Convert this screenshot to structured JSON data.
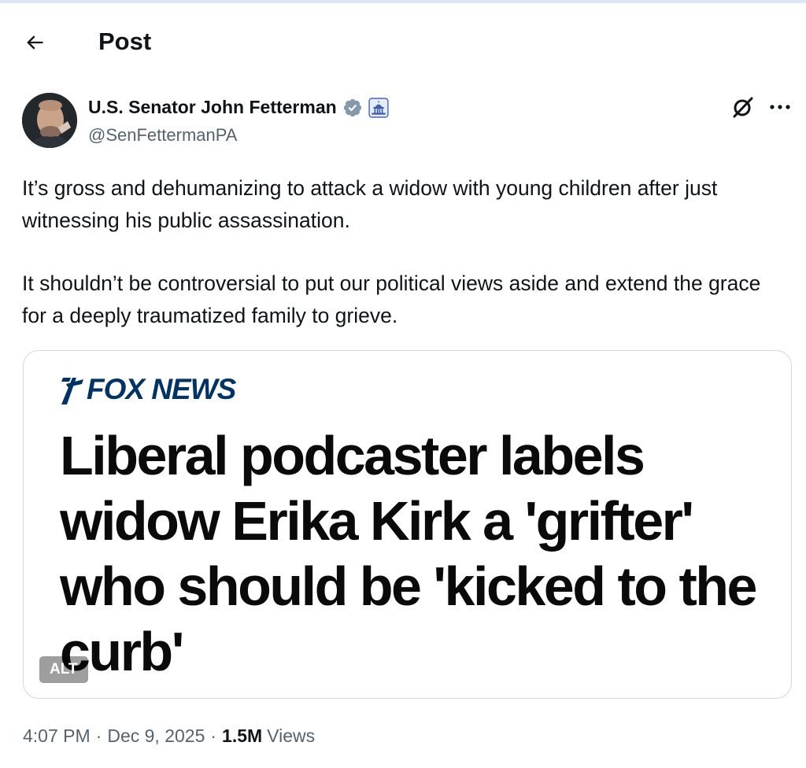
{
  "header": {
    "title": "Post"
  },
  "author": {
    "display_name": "U.S. Senator John Fetterman",
    "handle": "@SenFettermanPA",
    "verified_icon": "verified-badge-icon",
    "affiliation_icon": "us-capitol-icon",
    "verified_color": "#829aab"
  },
  "actions": {
    "grok_icon": "grok-icon",
    "more_icon": "more-icon"
  },
  "tweet": {
    "paragraphs": [
      "It’s gross and dehumanizing to attack a widow with young children after just witnessing his public assassination.",
      "It shouldn’t be controversial to put our political views aside and extend the grace for a deeply traumatized family to grieve."
    ]
  },
  "media": {
    "logo_text": "FOX NEWS",
    "headline": "Liberal podcaster labels widow Erika Kirk a 'grifter' who should be 'kicked to the curb'",
    "alt_label": "ALT",
    "brand_color": "#003366"
  },
  "meta": {
    "time": "4:07 PM",
    "date": "Dec 9, 2025",
    "views_count": "1.5M",
    "views_label": "Views",
    "separator": "·"
  }
}
